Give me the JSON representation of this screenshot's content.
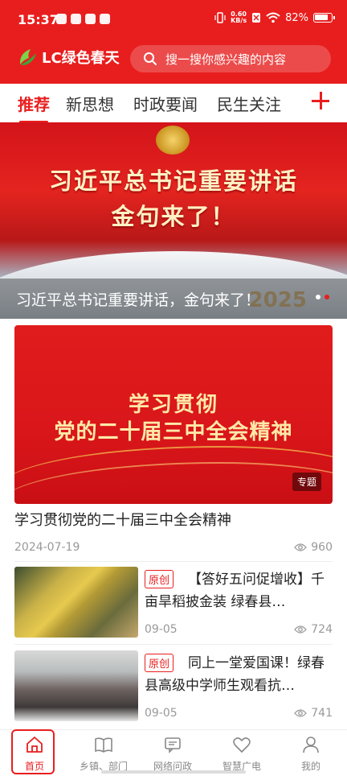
{
  "status_bar": {
    "time": "15:37",
    "network_speed": "0.60\nKB/s",
    "battery": "82%"
  },
  "app": {
    "logo_text": "LC绿色春天",
    "search_placeholder": "搜一搜你感兴趣的内容"
  },
  "tabs": [
    {
      "label": "推荐",
      "active": true
    },
    {
      "label": "新思想",
      "active": false
    },
    {
      "label": "时政要闻",
      "active": false
    },
    {
      "label": "民生关注",
      "active": false
    }
  ],
  "hero": {
    "headline_line1": "习近平总书记重要讲话",
    "headline_line2": "金句来了！",
    "bg_text": "2025",
    "caption": "习近平总书记重要讲话，金句来了！",
    "slide_count": 2,
    "active_slide": 2
  },
  "featured": {
    "banner_line1": "学习贯彻",
    "banner_line2": "党的二十届三中全会精神",
    "tag": "专题",
    "title": "学习贯彻党的二十届三中全会精神",
    "date": "2024-07-19",
    "views": "960"
  },
  "news": [
    {
      "badge": "原创",
      "title": "【答好五问促增收】千亩旱稻披金装 绿春县…",
      "date": "09-05",
      "views": "724"
    },
    {
      "badge": "原创",
      "title": "同上一堂爱国课！绿春县高级中学师生观看抗…",
      "date": "09-05",
      "views": "741"
    }
  ],
  "bottom_nav": [
    {
      "label": "首页",
      "icon": "home-icon",
      "active": true
    },
    {
      "label": "乡镇、部门",
      "icon": "book-icon",
      "active": false
    },
    {
      "label": "网络问政",
      "icon": "message-icon",
      "active": false
    },
    {
      "label": "智慧广电",
      "icon": "heart-icon",
      "active": false
    },
    {
      "label": "我的",
      "icon": "user-icon",
      "active": false
    }
  ],
  "colors": {
    "brand_red": "#e81e1e",
    "text_dark": "#222222",
    "text_muted": "#999999"
  }
}
